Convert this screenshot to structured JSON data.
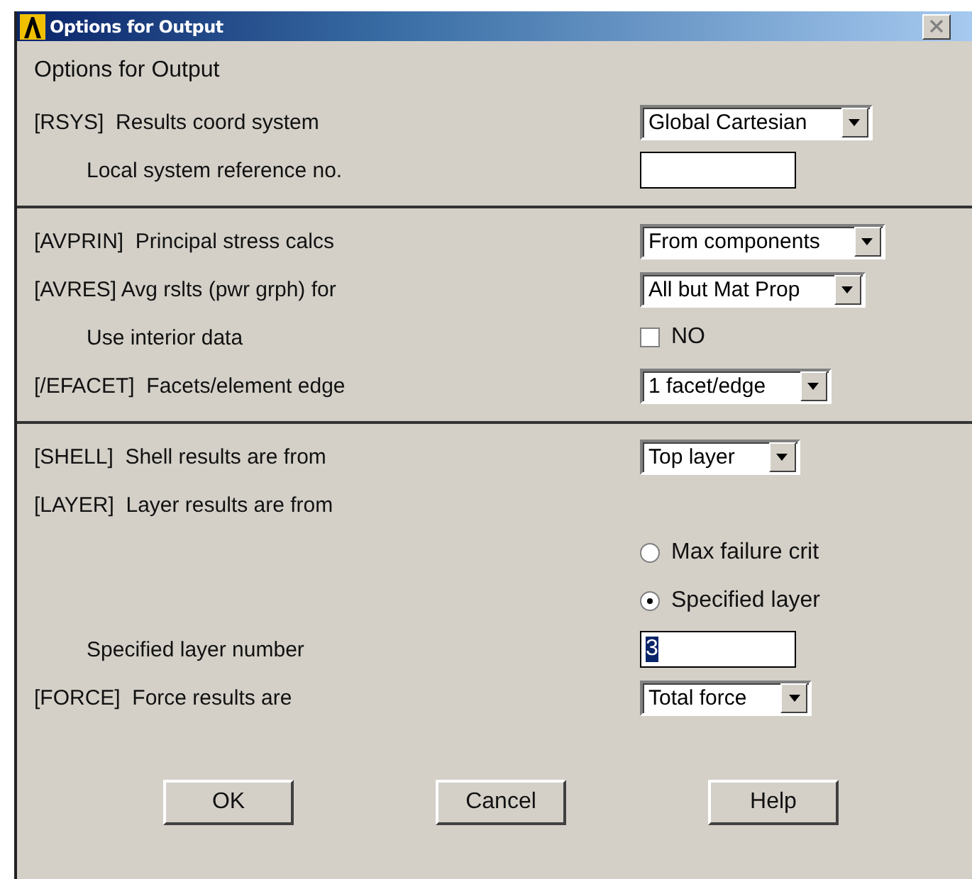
{
  "window": {
    "title": "Options for Output"
  },
  "heading": "Options for Output",
  "sections": [
    {
      "rows": [
        {
          "kind": "select",
          "label": "[RSYS]  Results coord system",
          "value": "Global Cartesian",
          "children": [
            {
              "kind": "input",
              "label": "Local system reference no."
            }
          ]
        }
      ]
    },
    {
      "rows": [
        {
          "kind": "select",
          "label": "[AVPRIN]  Principal stress calcs",
          "value": "From components"
        },
        {
          "kind": "select",
          "label": "[AVRES] Avg rslts (pwr grph) for",
          "value": "All but Mat Prop",
          "children": [
            {
              "kind": "checkbox",
              "label": "Use interior data",
              "value": "NO",
              "checked": false
            }
          ]
        },
        {
          "kind": "select",
          "label": "[/EFACET]  Facets/element edge",
          "value": "1 facet/edge"
        }
      ]
    },
    {
      "rows": [
        {
          "kind": "select",
          "label": "[SHELL]  Shell results are from",
          "value": "Top layer"
        },
        {
          "kind": "radio",
          "label": "[LAYER]  Layer results are from",
          "options": [
            {
              "label": "Max failure crit",
              "selected": false
            },
            {
              "label": "Specified layer",
              "selected": true
            }
          ],
          "children": [
            {
              "kind": "input",
              "label": "Specified layer number",
              "value": "3",
              "highlighted": true
            }
          ]
        },
        {
          "kind": "select",
          "label": "[FORCE]  Force results are",
          "value": "Total force"
        }
      ]
    }
  ],
  "buttons": [
    "OK",
    "Cancel",
    "Help"
  ]
}
